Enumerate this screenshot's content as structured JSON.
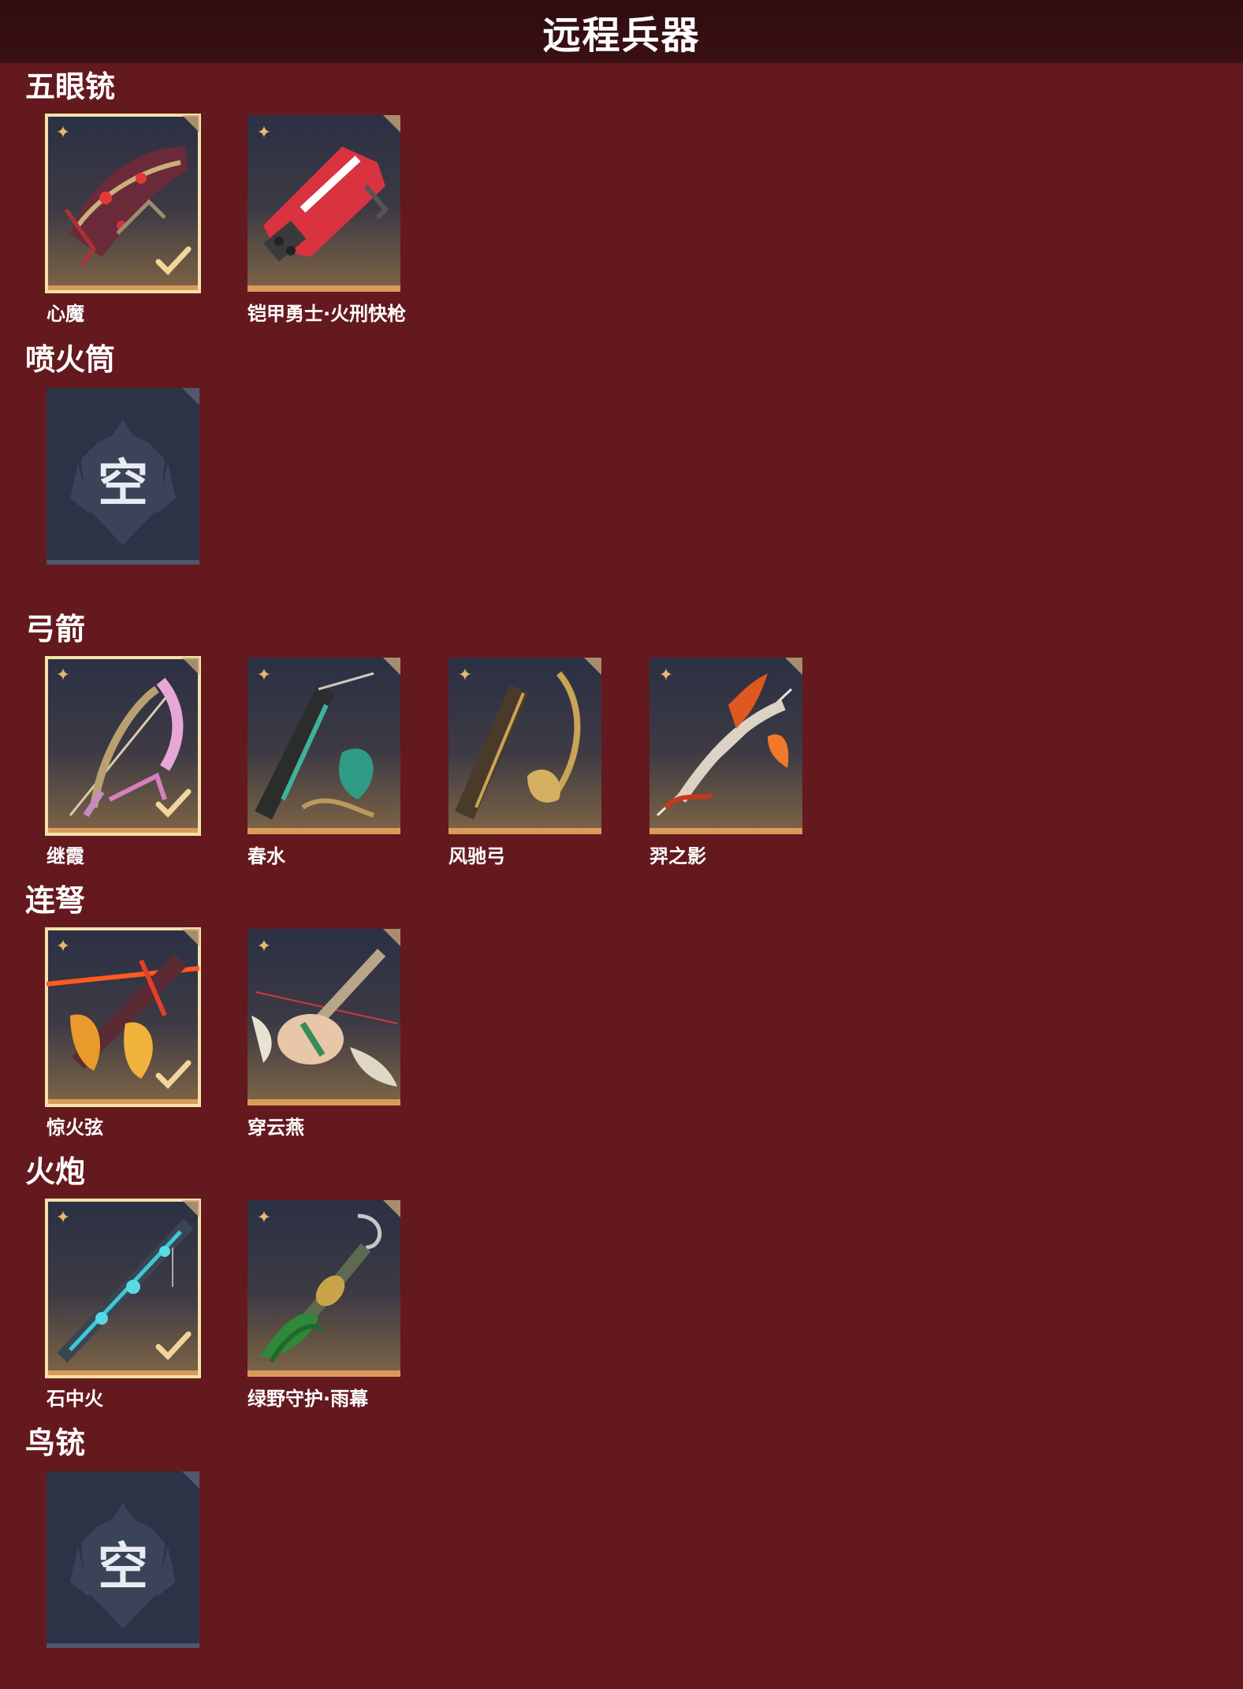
{
  "header": {
    "title": "远程兵器"
  },
  "colors": {
    "background": "#64191e",
    "header_bg": "#2e0d0f",
    "card_border": "#d99b5a",
    "equipped_outline": "#f3e2a8",
    "empty_card": "#2c3347"
  },
  "sections": [
    {
      "title": "五眼铳",
      "items": [
        {
          "name": "心魔",
          "equipped": true,
          "icon": "weapon-xinmo-icon"
        },
        {
          "name": "铠甲勇士·火刑快枪",
          "equipped": false,
          "icon": "weapon-armor-gun-icon"
        }
      ]
    },
    {
      "title": "喷火筒",
      "empty_label": "空"
    },
    {
      "title": "弓箭",
      "items": [
        {
          "name": "继霞",
          "equipped": true,
          "icon": "weapon-jixia-icon"
        },
        {
          "name": "春水",
          "equipped": false,
          "icon": "weapon-chunshui-icon"
        },
        {
          "name": "风驰弓",
          "equipped": false,
          "icon": "weapon-fengchi-icon"
        },
        {
          "name": "羿之影",
          "equipped": false,
          "icon": "weapon-yizhiying-icon"
        }
      ]
    },
    {
      "title": "连弩",
      "items": [
        {
          "name": "惊火弦",
          "equipped": true,
          "icon": "weapon-jinghuoxian-icon"
        },
        {
          "name": "穿云燕",
          "equipped": false,
          "icon": "weapon-chuanyunyan-icon"
        }
      ]
    },
    {
      "title": "火炮",
      "items": [
        {
          "name": "石中火",
          "equipped": true,
          "icon": "weapon-shizhonghuo-icon"
        },
        {
          "name": "绿野守护·雨幕",
          "equipped": false,
          "icon": "weapon-lvye-icon"
        }
      ]
    },
    {
      "title": "鸟铳",
      "empty_label": "空"
    }
  ]
}
